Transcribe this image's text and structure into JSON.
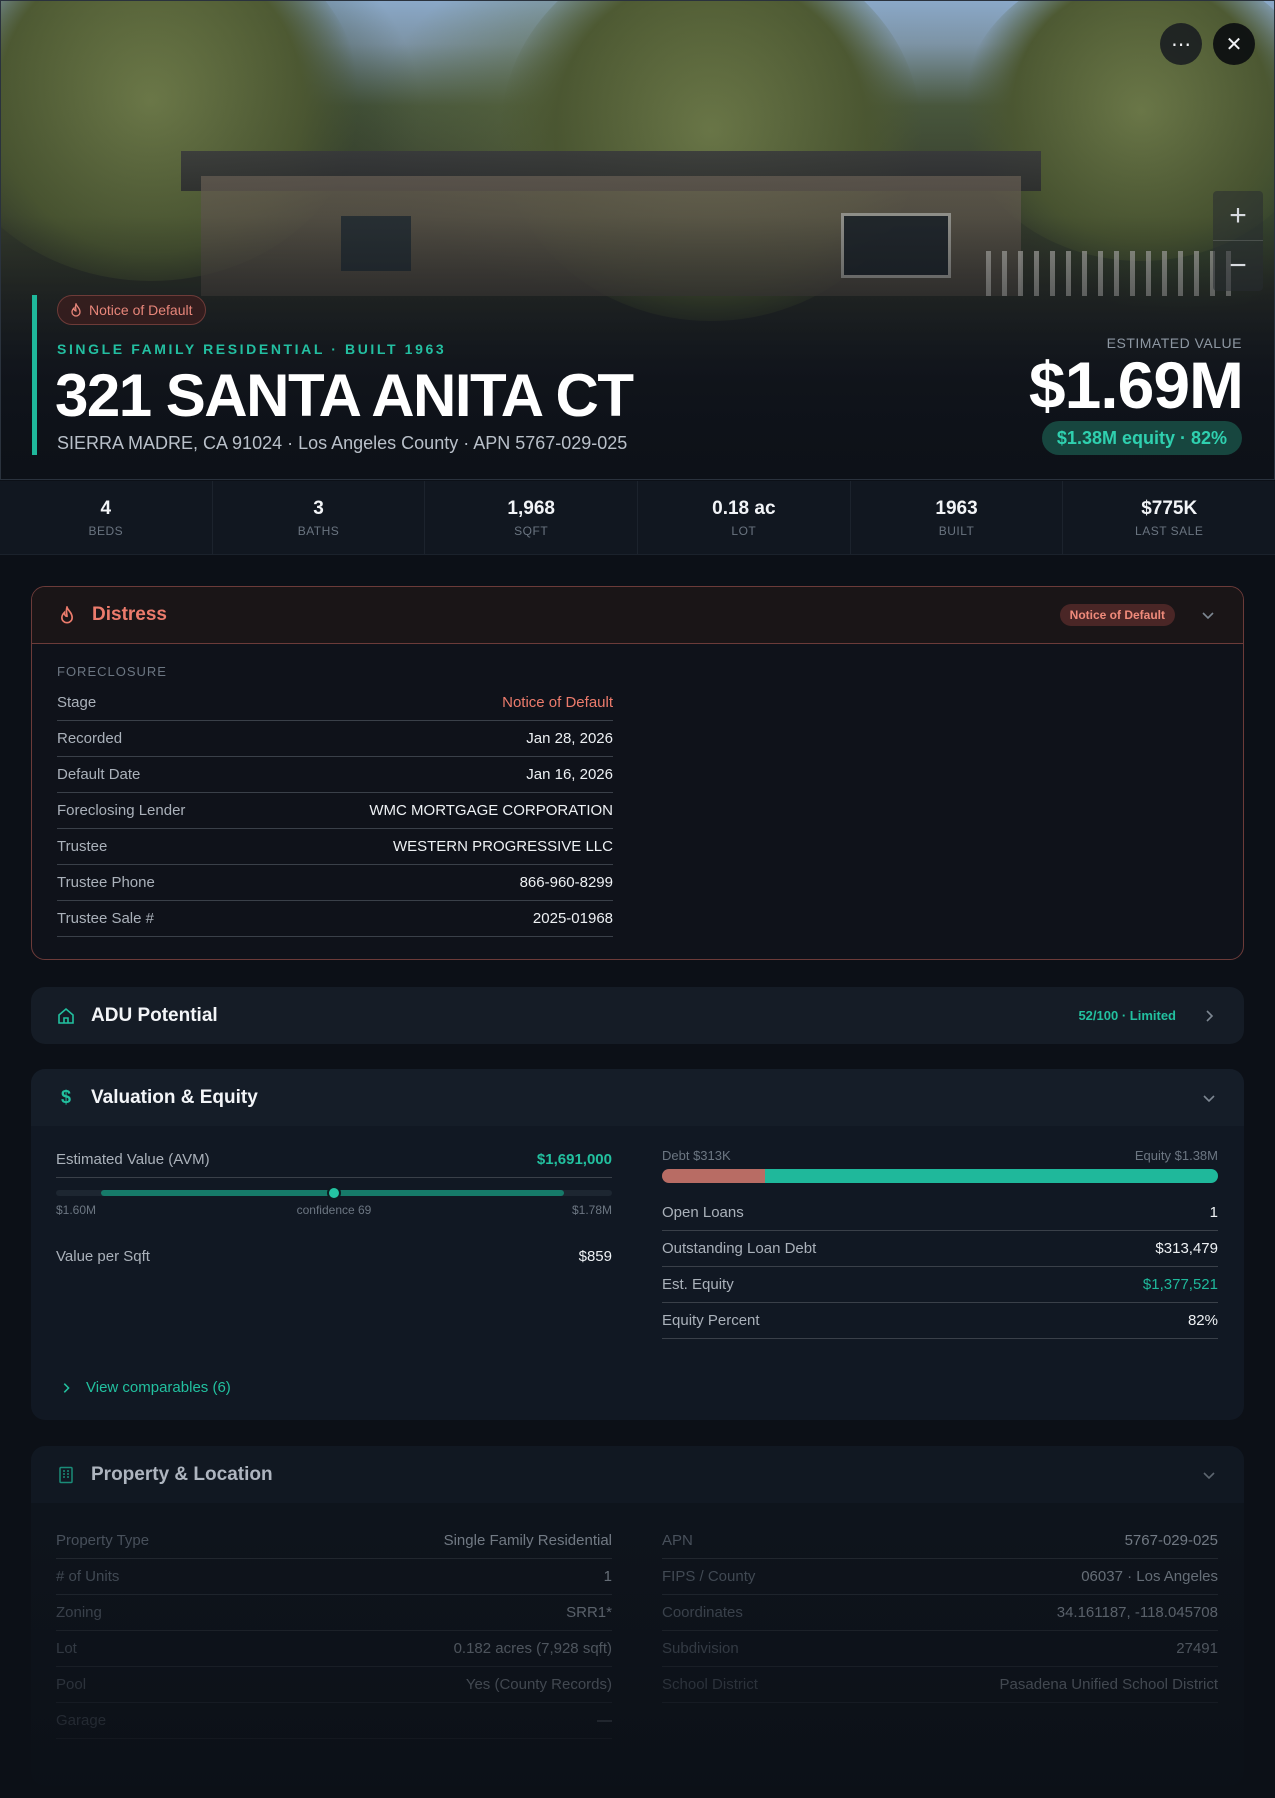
{
  "hero": {
    "distress_badge": "Notice of Default",
    "kicker": "SINGLE FAMILY RESIDENTIAL · BUILT 1963",
    "address": "321 SANTA ANITA CT",
    "subaddress": "SIERRA MADRE, CA 91024 · Los Angeles County · APN 5767-029-025",
    "estimated_label": "ESTIMATED VALUE",
    "estimated_value": "$1.69M",
    "equity_pill": "$1.38M equity · 82%",
    "more_icon": "⋯",
    "close_icon": "✕",
    "zoom_in": "+",
    "zoom_out": "−"
  },
  "stats": [
    {
      "value": "4",
      "label": "BEDS"
    },
    {
      "value": "3",
      "label": "BATHS"
    },
    {
      "value": "1,968",
      "label": "SQFT"
    },
    {
      "value": "0.18 ac",
      "label": "LOT"
    },
    {
      "value": "1963",
      "label": "BUILT"
    },
    {
      "value": "$775K",
      "label": "LAST SALE"
    }
  ],
  "distress": {
    "title": "Distress",
    "badge": "Notice of Default",
    "section_label": "FORECLOSURE",
    "rows": [
      {
        "k": "Stage",
        "v": "Notice of Default"
      },
      {
        "k": "Recorded",
        "v": "Jan 28, 2026"
      },
      {
        "k": "Default Date",
        "v": "Jan 16, 2026"
      },
      {
        "k": "Foreclosing Lender",
        "v": "WMC MORTGAGE CORPORATION"
      },
      {
        "k": "Trustee",
        "v": "WESTERN PROGRESSIVE LLC"
      },
      {
        "k": "Trustee Phone",
        "v": "866-960-8299"
      },
      {
        "k": "Trustee Sale #",
        "v": "2025-01968"
      }
    ]
  },
  "adu": {
    "title": "ADU Potential",
    "score": "52/100 · Limited"
  },
  "valuation": {
    "title": "Valuation & Equity",
    "avm_label": "Estimated Value (AVM)",
    "avm_value": "$1,691,000",
    "range_low": "$1.60M",
    "range_mid": "confidence 69",
    "range_high": "$1.78M",
    "per_sqft_label": "Value per Sqft",
    "per_sqft_value": "$859",
    "debt_label": "Debt $313K",
    "equity_label": "Equity $1.38M",
    "debt_fraction": 0.185,
    "rows": [
      {
        "k": "Open Loans",
        "v": "1"
      },
      {
        "k": "Outstanding Loan Debt",
        "v": "$313,479"
      },
      {
        "k": "Est. Equity",
        "v": "$1,377,521"
      },
      {
        "k": "Equity Percent",
        "v": "82%"
      }
    ],
    "comparables_link": "View comparables (6)"
  },
  "property": {
    "title": "Property & Location",
    "left": [
      {
        "k": "Property Type",
        "v": "Single Family Residential"
      },
      {
        "k": "# of Units",
        "v": "1"
      },
      {
        "k": "Zoning",
        "v": "SRR1*"
      },
      {
        "k": "Lot",
        "v": "0.182 acres (7,928 sqft)"
      },
      {
        "k": "Pool",
        "v": "Yes (County Records)"
      },
      {
        "k": "Garage",
        "v": "—"
      }
    ],
    "right": [
      {
        "k": "APN",
        "v": "5767-029-025"
      },
      {
        "k": "FIPS / County",
        "v": "06037 · Los Angeles"
      },
      {
        "k": "Coordinates",
        "v": "34.161187, -118.045708"
      },
      {
        "k": "Subdivision",
        "v": "27491"
      },
      {
        "k": "School District",
        "v": "Pasadena Unified School District"
      }
    ]
  },
  "colors": {
    "accent": "#1fb89b",
    "danger": "#ec7b6c",
    "debt_bar": "#b86c64",
    "equity_bar": "#1fb89b"
  }
}
